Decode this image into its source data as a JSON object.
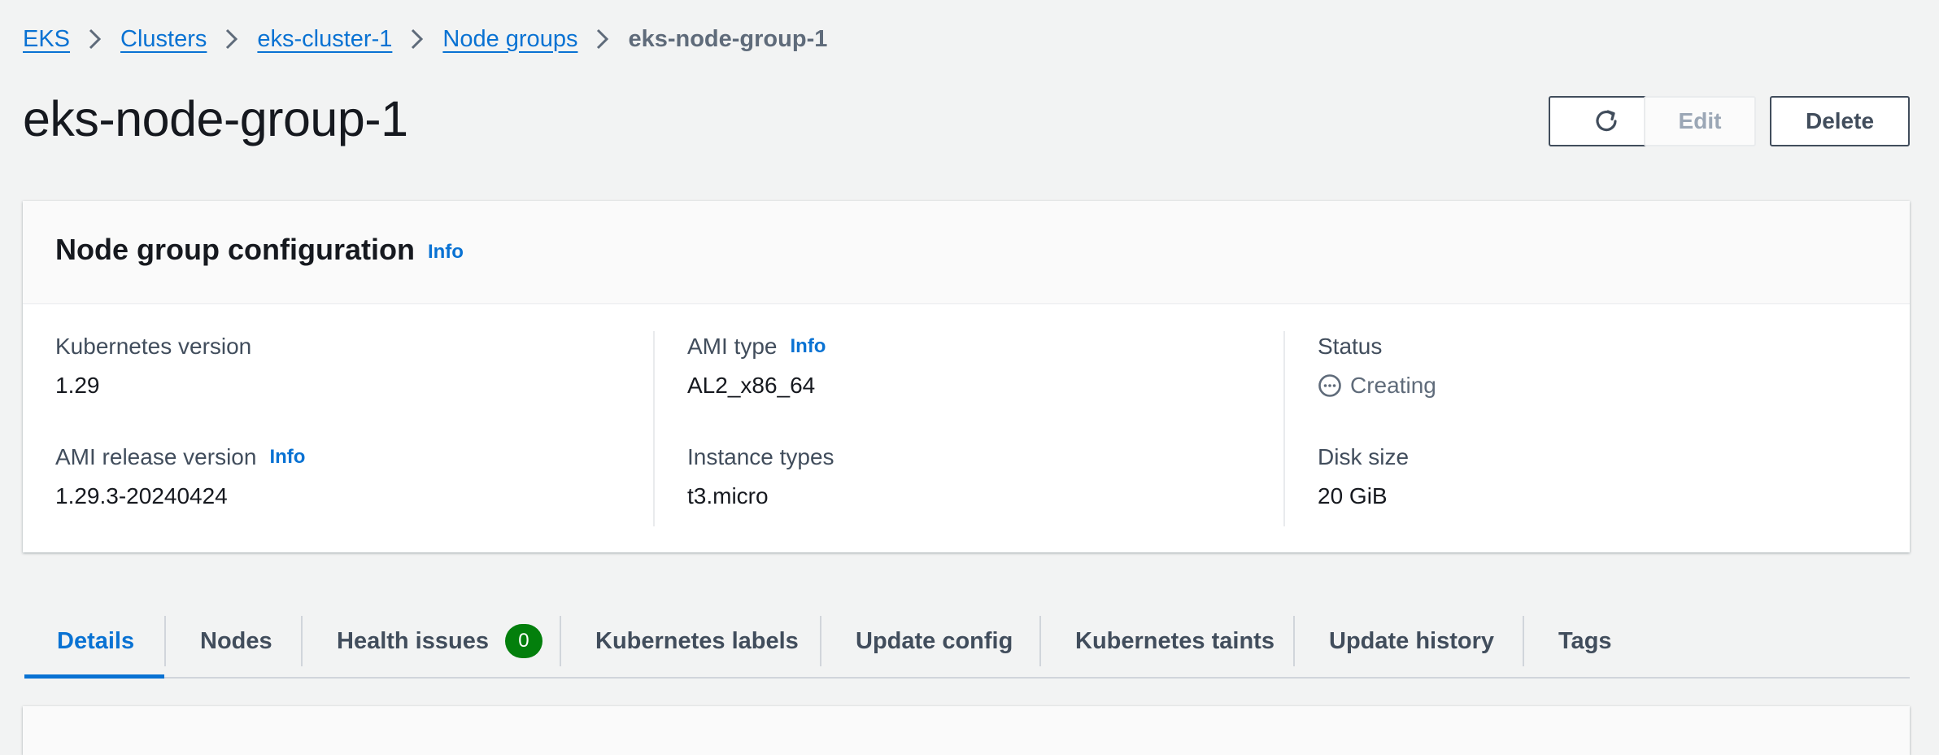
{
  "breadcrumb": {
    "items": [
      "EKS",
      "Clusters",
      "eks-cluster-1",
      "Node groups"
    ],
    "current": "eks-node-group-1"
  },
  "header": {
    "title": "eks-node-group-1",
    "refresh_icon": "refresh-icon",
    "edit_label": "Edit",
    "delete_label": "Delete"
  },
  "config": {
    "title": "Node group configuration",
    "info": "Info",
    "kubernetes_version": {
      "label": "Kubernetes version",
      "value": "1.29"
    },
    "ami_release_version": {
      "label": "AMI release version",
      "info": "Info",
      "value": "1.29.3-20240424"
    },
    "ami_type": {
      "label": "AMI type",
      "info": "Info",
      "value": "AL2_x86_64"
    },
    "instance_types": {
      "label": "Instance types",
      "value": "t3.micro"
    },
    "status": {
      "label": "Status",
      "value": "Creating",
      "icon": "pending-icon"
    },
    "disk_size": {
      "label": "Disk size",
      "value": "20 GiB"
    }
  },
  "tabs": [
    {
      "label": "Details",
      "active": true
    },
    {
      "label": "Nodes"
    },
    {
      "label": "Health issues",
      "badge": "0"
    },
    {
      "label": "Kubernetes labels"
    },
    {
      "label": "Update config"
    },
    {
      "label": "Kubernetes taints"
    },
    {
      "label": "Update history"
    },
    {
      "label": "Tags"
    }
  ],
  "colors": {
    "link": "#0972d3",
    "success_badge": "#037f0c",
    "background": "#f2f3f3"
  }
}
